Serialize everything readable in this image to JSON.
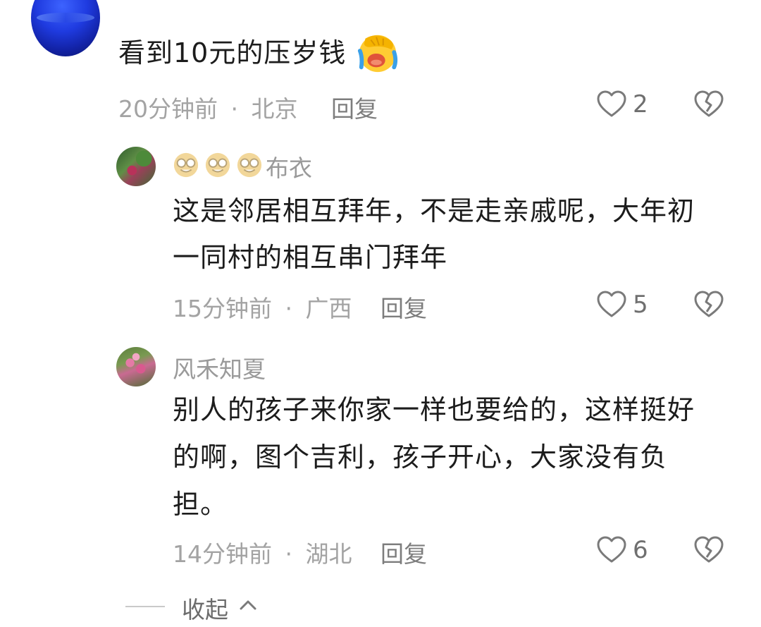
{
  "comments": [
    {
      "text": "看到10元的压岁钱",
      "emoji": "facepalm-crying-emoji",
      "time": "20分钟前",
      "separator": "·",
      "location": "北京",
      "reply_label": "回复",
      "likes": "2"
    }
  ],
  "replies": [
    {
      "username": "布衣",
      "username_prefix_emoji": [
        "nerd-face-emoji",
        "nerd-face-emoji",
        "nerd-face-emoji"
      ],
      "text_lines": [
        "这是邻居相互拜年，不是走亲戚呢，大年初",
        "一同村的相互串门拜年"
      ],
      "time": "15分钟前",
      "separator": "·",
      "location": "广西",
      "reply_label": "回复",
      "likes": "5"
    },
    {
      "username": "风禾知夏",
      "text_lines": [
        "别人的孩子来你家一样也要给的，这样挺好",
        "的啊，图个吉利，孩子开心，大家没有负",
        "担。"
      ],
      "time": "14分钟前",
      "separator": "·",
      "location": "湖北",
      "reply_label": "回复",
      "likes": "6"
    }
  ],
  "collapse_label": "收起",
  "icons": {
    "like": "heart-outline-icon",
    "dislike": "broken-heart-icon",
    "collapse": "chevron-up-icon"
  }
}
